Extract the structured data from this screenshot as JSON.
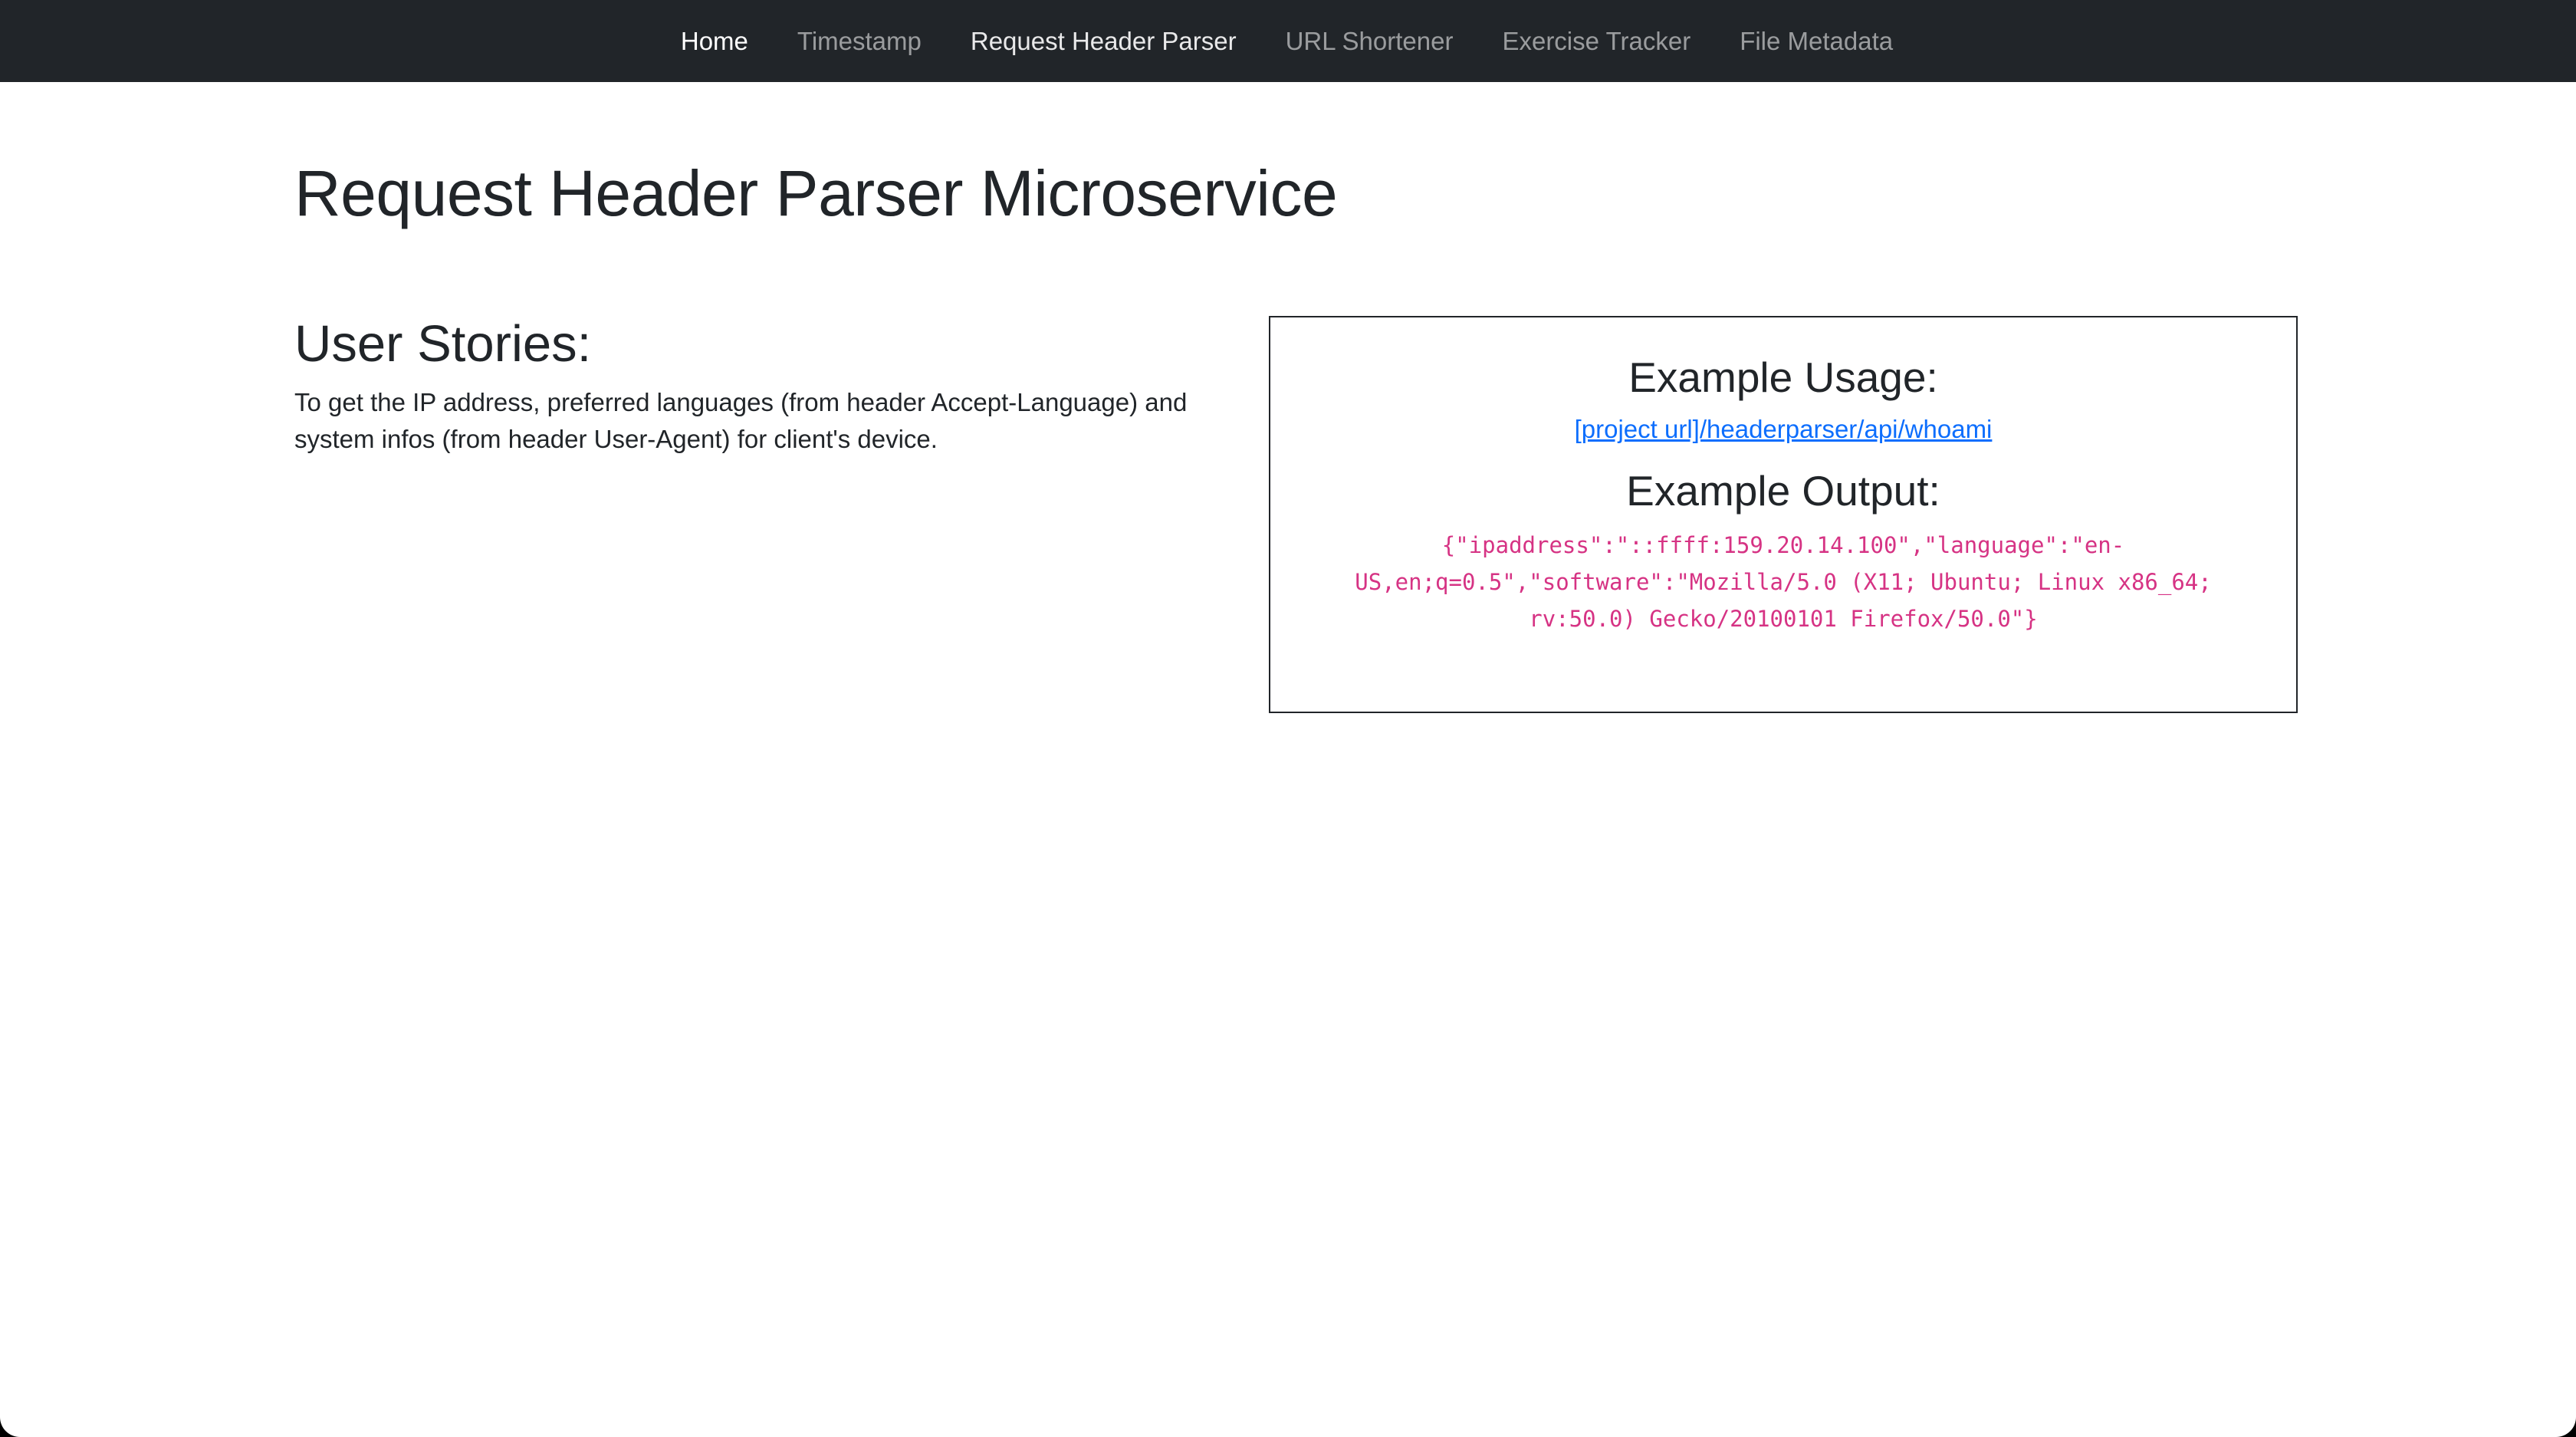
{
  "nav": {
    "items": [
      {
        "label": "Home",
        "state": "active"
      },
      {
        "label": "Timestamp",
        "state": "normal"
      },
      {
        "label": "Request Header Parser",
        "state": "bright"
      },
      {
        "label": "URL Shortener",
        "state": "normal"
      },
      {
        "label": "Exercise Tracker",
        "state": "normal"
      },
      {
        "label": "File Metadata",
        "state": "normal"
      }
    ]
  },
  "page": {
    "title": "Request Header Parser Microservice"
  },
  "user_stories": {
    "heading": "User Stories:",
    "text": "To get the IP address, preferred languages (from header Accept-Language) and system infos (from header User-Agent) for client's device."
  },
  "example": {
    "usage_heading": "Example Usage:",
    "usage_link": "[project url]/headerparser/api/whoami",
    "output_heading": "Example Output:",
    "output_code": "{\"ipaddress\":\"::ffff:159.20.14.100\",\"language\":\"en-US,en;q=0.5\",\"software\":\"Mozilla/5.0 (X11; Ubuntu; Linux x86_64; rv:50.0) Gecko/20100101 Firefox/50.0\"}"
  },
  "colors": {
    "navbar_bg": "#212529",
    "link": "#0d6efd",
    "code": "#d63384",
    "text": "#212529"
  }
}
